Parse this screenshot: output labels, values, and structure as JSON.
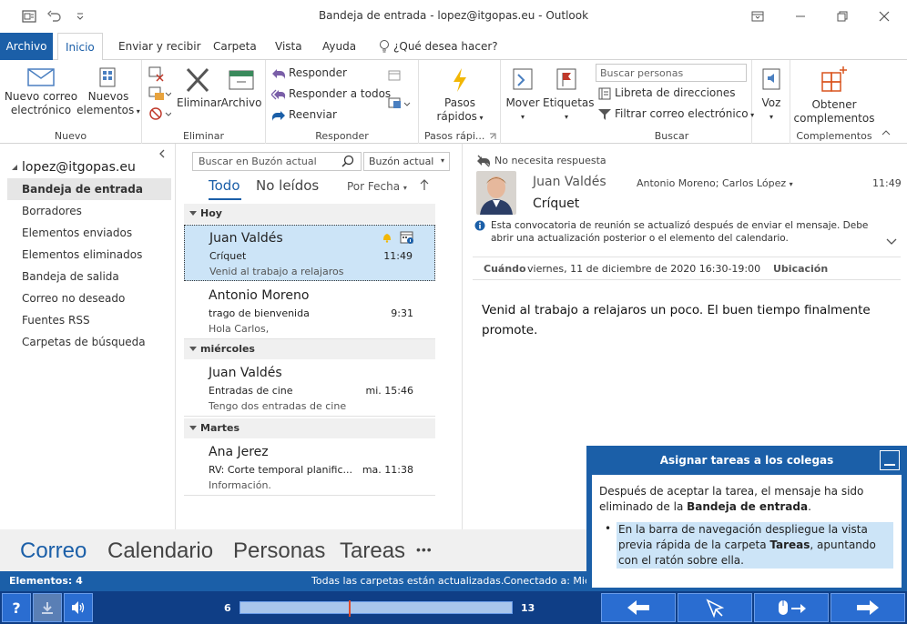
{
  "window": {
    "title": "Bandeja de entrada - lopez@itgopas.eu  -  Outlook"
  },
  "tabs": [
    "Archivo",
    "Inicio",
    "Enviar y recibir",
    "Carpeta",
    "Vista",
    "Ayuda",
    "¿Qué desea hacer?"
  ],
  "ribbon": {
    "nuevo": {
      "new_email": [
        "Nuevo correo",
        "electrónico"
      ],
      "new_items": [
        "Nuevos",
        "elementos"
      ],
      "label": "Nuevo"
    },
    "eliminar": {
      "delete": "Eliminar",
      "archive": "Archivo",
      "label": "Eliminar"
    },
    "responder": {
      "reply": "Responder",
      "reply_all": "Responder a todos",
      "forward": "Reenviar",
      "label": "Responder"
    },
    "pasos": {
      "quick_steps": [
        "Pasos",
        "rápidos"
      ],
      "label": "Pasos rápi..."
    },
    "mover": {
      "move": "Mover"
    },
    "etiquetas": {
      "tags": "Etiquetas"
    },
    "buscar": {
      "search_people_placeholder": "Buscar personas",
      "address_book": "Libreta de direcciones",
      "filter_email": "Filtrar correo electrónico",
      "label": "Buscar"
    },
    "voz": {
      "voice": "Voz"
    },
    "complementos": {
      "get_addins": [
        "Obtener",
        "complementos"
      ],
      "label": "Complementos"
    }
  },
  "nav": {
    "account": "lopez@itgopas.eu",
    "folders": [
      "Bandeja de entrada",
      "Borradores",
      "Elementos enviados",
      "Elementos eliminados",
      "Bandeja de salida",
      "Correo no deseado",
      "Fuentes RSS",
      "Carpetas de búsqueda"
    ]
  },
  "list": {
    "search_placeholder": "Buscar en Buzón actual",
    "scope": "Buzón actual",
    "filter_all": "Todo",
    "filter_unread": "No leídos",
    "sort": "Por Fecha",
    "groups": [
      {
        "label": "Hoy",
        "messages": [
          {
            "from": "Juan Valdés",
            "subject": "Críquet",
            "preview": "Venid al trabajo a relajaros",
            "time": "11:49"
          },
          {
            "from": "Antonio Moreno",
            "subject": "trago de bienvenida",
            "preview": "Hola Carlos,",
            "time": "9:31"
          }
        ]
      },
      {
        "label": "miércoles",
        "messages": [
          {
            "from": "Juan Valdés",
            "subject": "Entradas de cine",
            "preview": "Tengo dos entradas de cine",
            "time": "mi. 15:46"
          }
        ]
      },
      {
        "label": "Martes",
        "messages": [
          {
            "from": "Ana Jerez",
            "subject": "RV: Corte temporal planific...",
            "preview": "Información.",
            "time": "ma. 11:38"
          }
        ]
      }
    ]
  },
  "reading": {
    "no_reply": "No necesita respuesta",
    "sender": "Juan Valdés",
    "recipients": "Antonio Moreno; Carlos López",
    "time": "11:49",
    "subject": "Críquet",
    "info": "Esta convocatoria de reunión se actualizó después de enviar el mensaje. Debe abrir una actualización posterior o el elemento del calendario.",
    "when_label": "Cuándo",
    "when_value": "viernes, 11 de diciembre de 2020 16:30-19:00",
    "location_label": "Ubicación",
    "body": "Venid al trabajo a relajaros un poco. El buen tiempo finalmente promote."
  },
  "navbar": {
    "items": [
      "Correo",
      "Calendario",
      "Personas",
      "Tareas"
    ],
    "more": "•••"
  },
  "status": {
    "items": "Elementos: 4",
    "folders_updated": "Todas las carpetas están actualizadas.",
    "connected": "Conectado a: Mic"
  },
  "tutorial": {
    "title": "Asignar tareas a los colegas",
    "para_pre": "Después de aceptar la tarea, el mensaje ha sido eliminado de la ",
    "para_bold": "Bandeja de entrada",
    "para_post": ".",
    "bullet_pre": "En la barra de navegación despliegue la vista previa rápida de la carpeta ",
    "bullet_bold": "Tareas",
    "bullet_post": ", apuntando con el ratón sobre ella."
  },
  "player": {
    "help": "?",
    "progress_start": "6",
    "progress_end": "13",
    "progress_fraction": 0.4
  }
}
